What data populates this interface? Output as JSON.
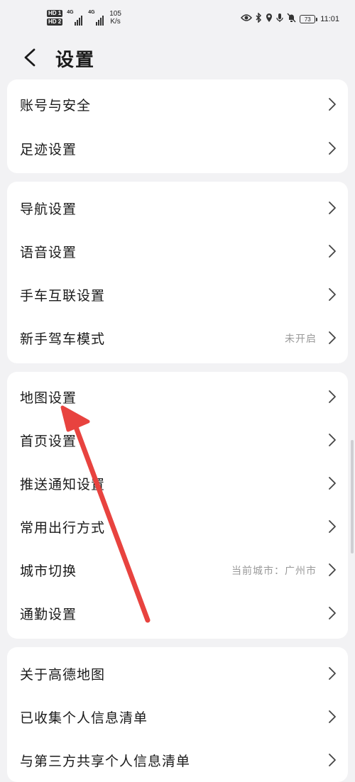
{
  "status_bar": {
    "hd1": "HD 1",
    "hd2": "HD 2",
    "network1": "4G",
    "network2": "4G",
    "speed_value": "105",
    "speed_unit": "K/s",
    "battery": "73",
    "time": "11:01"
  },
  "header": {
    "title": "设置"
  },
  "groups": [
    {
      "items": [
        {
          "label": "账号与安全"
        },
        {
          "label": "足迹设置"
        }
      ]
    },
    {
      "items": [
        {
          "label": "导航设置"
        },
        {
          "label": "语音设置"
        },
        {
          "label": "手车互联设置"
        },
        {
          "label": "新手驾车模式",
          "value": "未开启"
        }
      ]
    },
    {
      "items": [
        {
          "label": "地图设置"
        },
        {
          "label": "首页设置"
        },
        {
          "label": "推送通知设置"
        },
        {
          "label": "常用出行方式"
        },
        {
          "label": "城市切换",
          "value": "当前城市：广州市"
        },
        {
          "label": "通勤设置"
        }
      ]
    },
    {
      "items": [
        {
          "label": "关于高德地图"
        },
        {
          "label": "已收集个人信息清单"
        },
        {
          "label": "与第三方共享个人信息清单"
        }
      ]
    }
  ],
  "colors": {
    "background": "#f2f2f4",
    "card": "#ffffff",
    "annotation_arrow": "#e8433f",
    "secondary_text": "#9a9a9a"
  },
  "icons": {
    "back": "chevron-left-icon",
    "row_arrow": "chevron-right-icon"
  }
}
